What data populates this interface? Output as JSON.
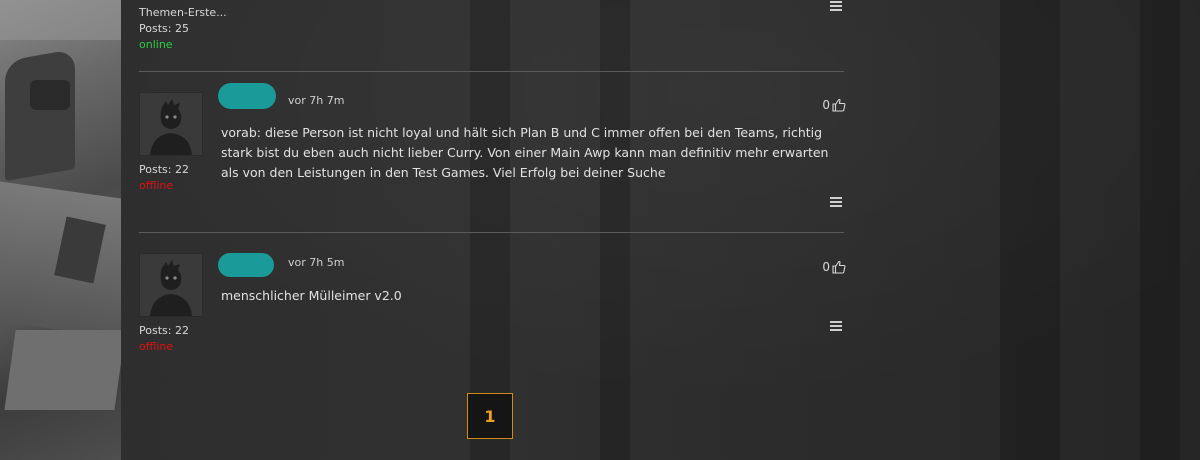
{
  "previous_post": {
    "author_role": "Themen-Erste...",
    "posts": "Posts: 25",
    "status": "online"
  },
  "posts": [
    {
      "time": "vor 7h 7m",
      "likes": "0",
      "body": "vorab: diese Person ist nicht loyal und hält sich Plan B und C immer offen bei den Teams, richtig stark bist du eben auch nicht lieber Curry. Von einer Main Awp kann man definitiv mehr erwarten als von den Leistungen in den Test Games. Viel Erfolg bei deiner Suche",
      "posts": "Posts: 22",
      "status": "offline"
    },
    {
      "time": "vor 7h 5m",
      "likes": "0",
      "body": "menschlicher Mülleimer v2.0",
      "posts": "Posts: 22",
      "status": "offline"
    }
  ],
  "pagination": {
    "current_page": "1"
  },
  "colors": {
    "online": "#2ecc40",
    "offline": "#e01010",
    "accent": "#f0a020",
    "redaction": "#1b9a9a"
  }
}
